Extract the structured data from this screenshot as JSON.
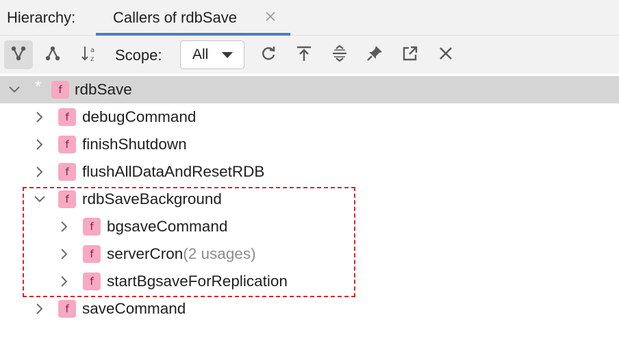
{
  "tabbar": {
    "hierarchy_label": "Hierarchy:",
    "active_tab": {
      "title": "Callers of rdbSave",
      "close_icon": "close-icon"
    }
  },
  "toolbar": {
    "buttons": [
      {
        "name": "caller-hierarchy-icon",
        "active": true
      },
      {
        "name": "callee-hierarchy-icon",
        "active": false
      },
      {
        "name": "sort-alphabetically-icon",
        "active": false
      },
      {
        "name": "refresh-icon",
        "active": false
      },
      {
        "name": "go-to-top-icon",
        "active": false
      },
      {
        "name": "expand-all-icon",
        "active": false
      },
      {
        "name": "pin-icon",
        "active": false
      },
      {
        "name": "open-in-new-tab-icon",
        "active": false
      },
      {
        "name": "close-icon",
        "active": false
      }
    ],
    "scope_label": "Scope:",
    "scope_value": "All"
  },
  "tree": {
    "root": {
      "label": "rdbSave",
      "star": "*",
      "icon": "f"
    },
    "items": [
      {
        "label": "debugCommand",
        "icon": "f",
        "usage": ""
      },
      {
        "label": "finishShutdown",
        "icon": "f",
        "usage": ""
      },
      {
        "label": "flushAllDataAndResetRDB",
        "icon": "f",
        "usage": ""
      },
      {
        "label": "rdbSaveBackground",
        "icon": "f",
        "usage": "",
        "children": [
          {
            "label": "bgsaveCommand",
            "icon": "f",
            "usage": ""
          },
          {
            "label": "serverCron",
            "icon": "f",
            "usage": "(2 usages)"
          },
          {
            "label": "startBgsaveForReplication",
            "icon": "f",
            "usage": ""
          }
        ]
      },
      {
        "label": "saveCommand",
        "icon": "f",
        "usage": ""
      }
    ]
  },
  "colors": {
    "tab_underline": "#4a7fbf",
    "function_icon_bg": "#f7a9c1",
    "selected_row": "#d5d5d5",
    "highlight_border": "#d9232a"
  }
}
